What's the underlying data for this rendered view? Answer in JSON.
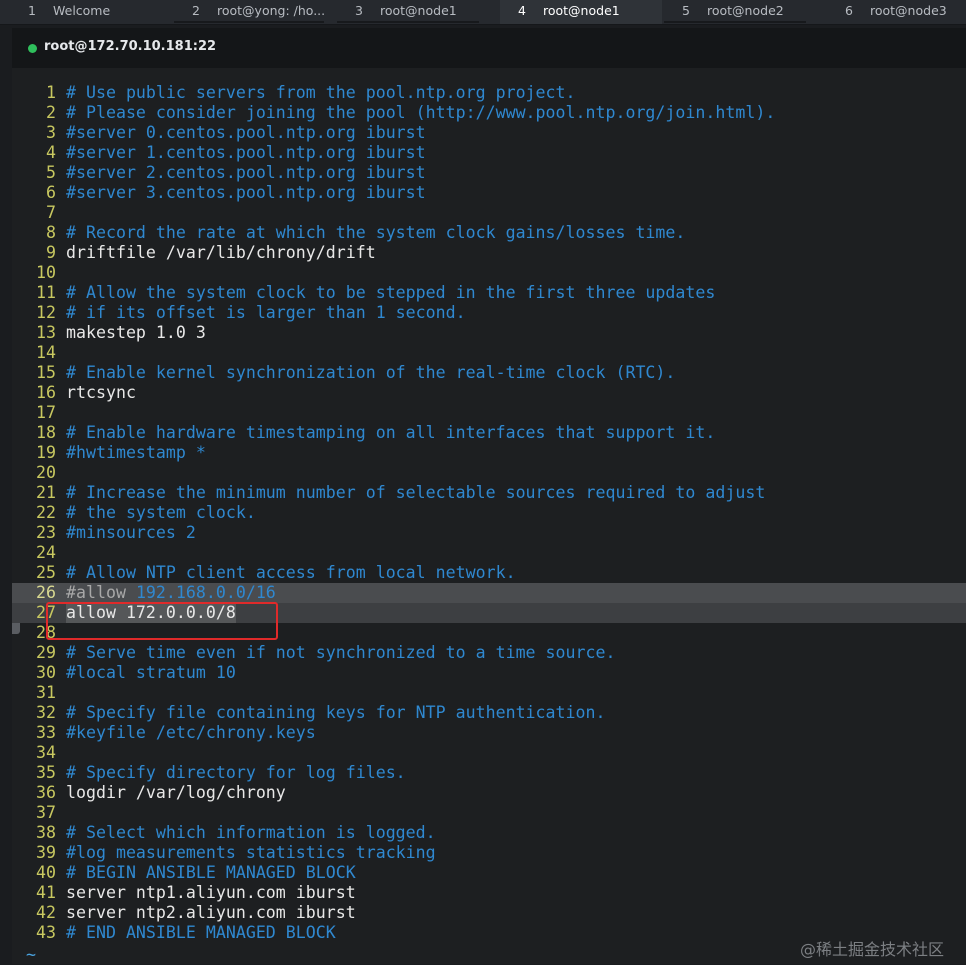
{
  "tabs": [
    {
      "num": "1",
      "label": "Welcome"
    },
    {
      "num": "2",
      "label": "root@yong: /ho..."
    },
    {
      "num": "3",
      "label": "root@node1"
    },
    {
      "num": "4",
      "label": "root@node1"
    },
    {
      "num": "5",
      "label": "root@node2"
    },
    {
      "num": "6",
      "label": "root@node3"
    }
  ],
  "session": {
    "host": "root@172.70.10.181:22",
    "status_color": "#2fbf5c"
  },
  "editor": {
    "lines": [
      {
        "n": "1",
        "text": "# Use public servers from the pool.ntp.org project."
      },
      {
        "n": "2",
        "text": "# Please consider joining the pool (http://www.pool.ntp.org/join.html)."
      },
      {
        "n": "3",
        "text": "#server 0.centos.pool.ntp.org iburst"
      },
      {
        "n": "4",
        "text": "#server 1.centos.pool.ntp.org iburst"
      },
      {
        "n": "5",
        "text": "#server 2.centos.pool.ntp.org iburst"
      },
      {
        "n": "6",
        "text": "#server 3.centos.pool.ntp.org iburst"
      },
      {
        "n": "7",
        "text": ""
      },
      {
        "n": "8",
        "text": "# Record the rate at which the system clock gains/losses time."
      },
      {
        "n": "9",
        "text": "driftfile /var/lib/chrony/drift"
      },
      {
        "n": "10",
        "text": ""
      },
      {
        "n": "11",
        "text": "# Allow the system clock to be stepped in the first three updates"
      },
      {
        "n": "12",
        "text": "# if its offset is larger than 1 second."
      },
      {
        "n": "13",
        "text": "makestep 1.0 3"
      },
      {
        "n": "14",
        "text": ""
      },
      {
        "n": "15",
        "text": "# Enable kernel synchronization of the real-time clock (RTC)."
      },
      {
        "n": "16",
        "text": "rtcsync"
      },
      {
        "n": "17",
        "text": ""
      },
      {
        "n": "18",
        "text": "# Enable hardware timestamping on all interfaces that support it."
      },
      {
        "n": "19",
        "text": "#hwtimestamp *"
      },
      {
        "n": "20",
        "text": ""
      },
      {
        "n": "21",
        "text": "# Increase the minimum number of selectable sources required to adjust"
      },
      {
        "n": "22",
        "text": "# the system clock."
      },
      {
        "n": "23",
        "text": "#minsources 2"
      },
      {
        "n": "24",
        "text": ""
      },
      {
        "n": "25",
        "text": "# Allow NTP client access from local network."
      },
      {
        "n": "26",
        "text_a": "#allow ",
        "text_b": "192.168.0.0/16"
      },
      {
        "n": "27",
        "text": "allow 172.0.0.0/8"
      },
      {
        "n": "28",
        "text": ""
      },
      {
        "n": "29",
        "text": "# Serve time even if not synchronized to a time source."
      },
      {
        "n": "30",
        "text": "#local stratum 10"
      },
      {
        "n": "31",
        "text": ""
      },
      {
        "n": "32",
        "text": "# Specify file containing keys for NTP authentication."
      },
      {
        "n": "33",
        "text": "#keyfile /etc/chrony.keys"
      },
      {
        "n": "34",
        "text": ""
      },
      {
        "n": "35",
        "text": "# Specify directory for log files."
      },
      {
        "n": "36",
        "text": "logdir /var/log/chrony"
      },
      {
        "n": "37",
        "text": ""
      },
      {
        "n": "38",
        "text": "# Select which information is logged."
      },
      {
        "n": "39",
        "text": "#log measurements statistics tracking"
      },
      {
        "n": "40",
        "text": "# BEGIN ANSIBLE MANAGED BLOCK"
      },
      {
        "n": "41",
        "text": "server ntp1.aliyun.com iburst"
      },
      {
        "n": "42",
        "text": "server ntp2.aliyun.com iburst"
      },
      {
        "n": "43",
        "text": "# END ANSIBLE MANAGED BLOCK"
      }
    ],
    "tilde": "~"
  },
  "watermark": "@稀土掘金技术社区"
}
